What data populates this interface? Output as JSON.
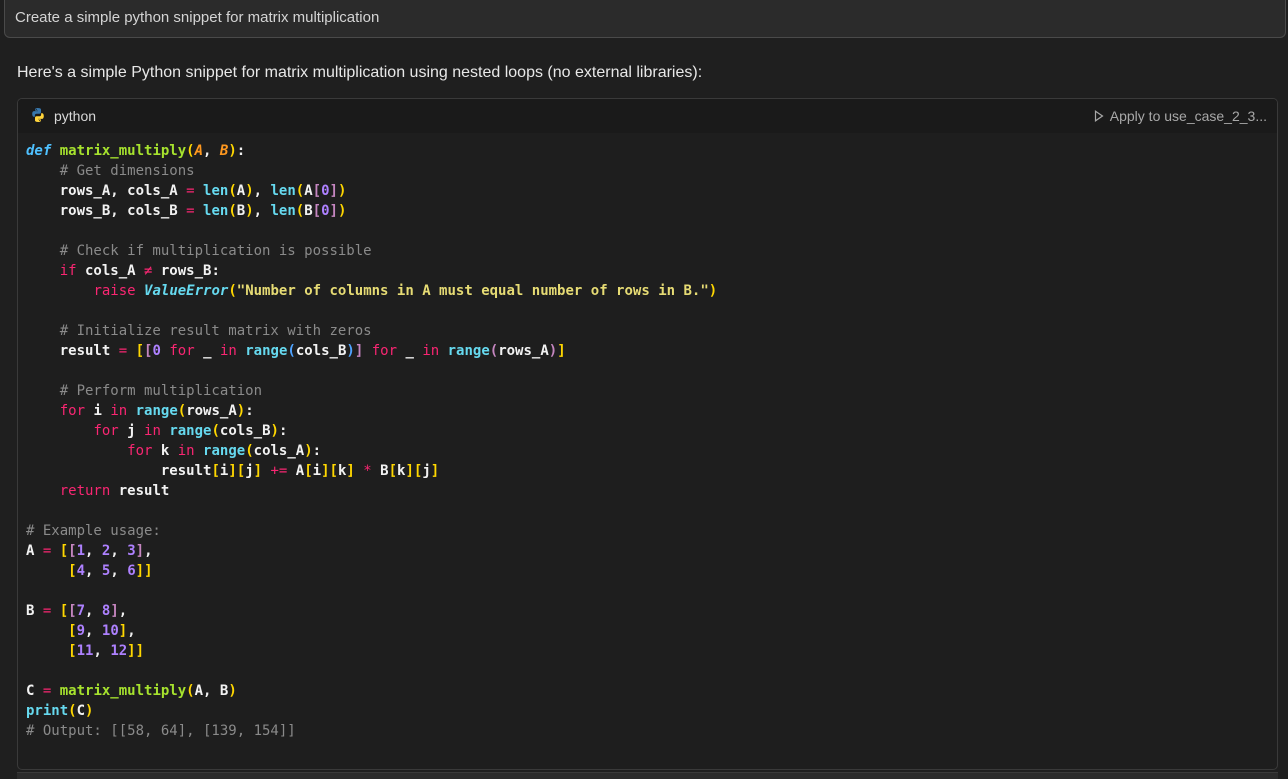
{
  "prompt": {
    "text": "Create a simple python snippet for matrix multiplication"
  },
  "answer": {
    "intro": "Here's a simple Python snippet for matrix multiplication using nested loops (no external libraries):"
  },
  "code_block": {
    "language": "python",
    "apply_label": "Apply to use_case_2_3...",
    "icons": [
      "python-icon",
      "play-triangle-icon"
    ],
    "lines": [
      "def matrix_multiply(A, B):",
      "    # Get dimensions",
      "    rows_A, cols_A = len(A), len(A[0])",
      "    rows_B, cols_B = len(B), len(B[0])",
      "",
      "    # Check if multiplication is possible",
      "    if cols_A ≠ rows_B:",
      "        raise ValueError(\"Number of columns in A must equal number of rows in B.\")",
      "",
      "    # Initialize result matrix with zeros",
      "    result = [[0 for _ in range(cols_B)] for _ in range(rows_A)]",
      "",
      "    # Perform multiplication",
      "    for i in range(rows_A):",
      "        for j in range(cols_B):",
      "            for k in range(cols_A):",
      "                result[i][j] += A[i][k] * B[k][j]",
      "    return result",
      "",
      "# Example usage:",
      "A = [[1, 2, 3],",
      "     [4, 5, 6]]",
      "",
      "B = [[7, 8],",
      "     [9, 10],",
      "     [11, 12]]",
      "",
      "C = matrix_multiply(A, B)",
      "print(C)",
      "# Output: [[58, 64], [139, 154]]"
    ]
  },
  "colors": {
    "background": "#1f1f1f",
    "keyword": "#f92672",
    "function": "#a6e22e",
    "builtin": "#66d9ef",
    "string": "#e6db74",
    "number": "#ae81ff",
    "comment": "#8a8a8a",
    "bracket": "#ffd700"
  }
}
